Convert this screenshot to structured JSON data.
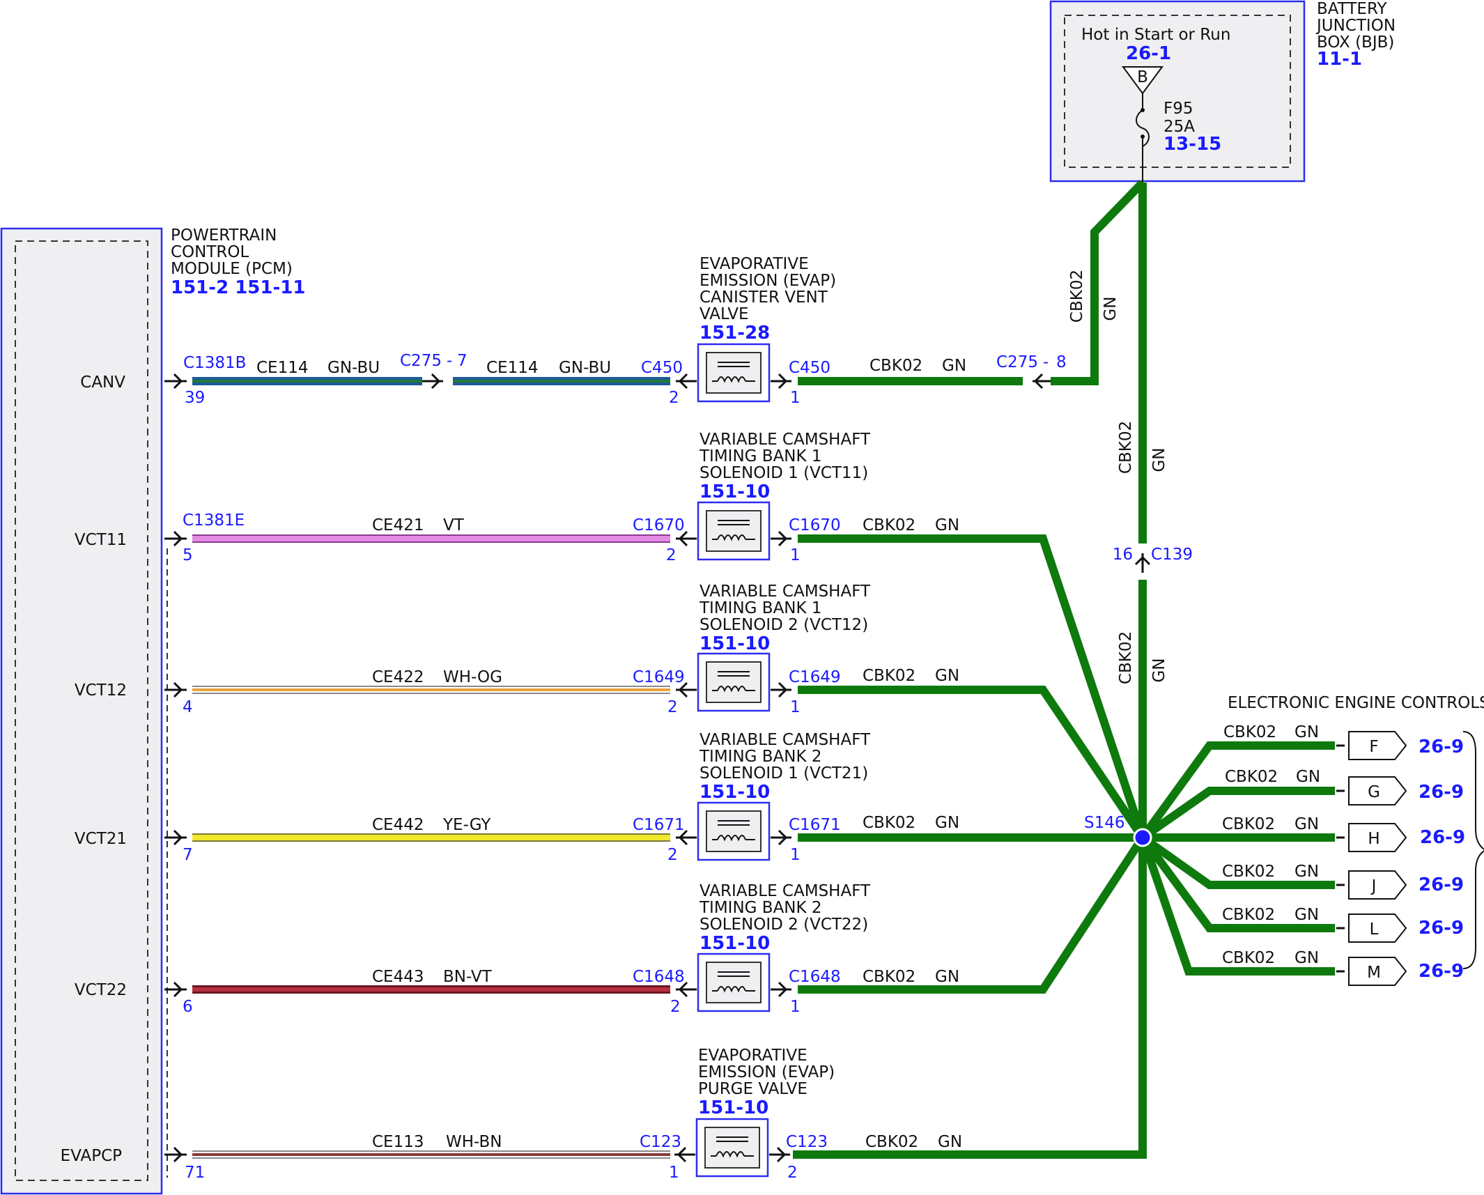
{
  "colors": {
    "module_border": "#2d2df0",
    "module_fill": "#efeff2",
    "link_blue": "#1a1aff",
    "wire_green": "#0e7a0e"
  },
  "pcm": {
    "name_lines": [
      "POWERTRAIN",
      "CONTROL",
      "MODULE (PCM)"
    ],
    "refs": "151-2  151-11",
    "pins": [
      "CANV",
      "VCT11",
      "VCT12",
      "VCT21",
      "VCT22",
      "EVAPCP"
    ]
  },
  "bjb": {
    "name_lines": [
      "BATTERY",
      "JUNCTION",
      "BOX (BJB)"
    ],
    "ref": "11-1",
    "hot_label": "Hot in Start or Run",
    "hot_ref": "26-1",
    "bus_letter": "B",
    "fuse_name": "F95",
    "fuse_rating": "25A",
    "fuse_ref": "13-15"
  },
  "circuits": [
    {
      "pin": "CANV",
      "pcm_connector": "C1381B",
      "pcm_pin": "39",
      "inline_connector": "C275",
      "inline_pin_left": "7",
      "circuit": "CE114",
      "color": "GN-BU",
      "component_lines": [
        "EVAPORATIVE",
        "EMISSION (EVAP)",
        "CANISTER VENT",
        "VALVE"
      ],
      "component_ref": "151-28",
      "comp_connector": "C450",
      "comp_pin_in": "2",
      "comp_pin_out": "1",
      "ret_circuit": "CBK02",
      "ret_color": "GN",
      "ret_inline_connector": "C275",
      "ret_inline_pin": "8"
    },
    {
      "pin": "VCT11",
      "pcm_connector": "C1381E",
      "pcm_pin": "5",
      "circuit": "CE421",
      "color": "VT",
      "component_lines": [
        "VARIABLE CAMSHAFT",
        "TIMING BANK 1",
        "SOLENOID 1 (VCT11)"
      ],
      "component_ref": "151-10",
      "comp_connector": "C1670",
      "comp_pin_in": "2",
      "comp_pin_out": "1",
      "ret_circuit": "CBK02",
      "ret_color": "GN"
    },
    {
      "pin": "VCT12",
      "pcm_pin": "4",
      "circuit": "CE422",
      "color": "WH-OG",
      "component_lines": [
        "VARIABLE CAMSHAFT",
        "TIMING BANK 1",
        "SOLENOID 2 (VCT12)"
      ],
      "component_ref": "151-10",
      "comp_connector": "C1649",
      "comp_pin_in": "2",
      "comp_pin_out": "1",
      "ret_circuit": "CBK02",
      "ret_color": "GN"
    },
    {
      "pin": "VCT21",
      "pcm_pin": "7",
      "circuit": "CE442",
      "color": "YE-GY",
      "component_lines": [
        "VARIABLE CAMSHAFT",
        "TIMING BANK 2",
        "SOLENOID 1 (VCT21)"
      ],
      "component_ref": "151-10",
      "comp_connector": "C1671",
      "comp_pin_in": "2",
      "comp_pin_out": "1",
      "ret_circuit": "CBK02",
      "ret_color": "GN"
    },
    {
      "pin": "VCT22",
      "pcm_pin": "6",
      "circuit": "CE443",
      "color": "BN-VT",
      "component_lines": [
        "VARIABLE CAMSHAFT",
        "TIMING BANK 2",
        "SOLENOID 2 (VCT22)"
      ],
      "component_ref": "151-10",
      "comp_connector": "C1648",
      "comp_pin_in": "2",
      "comp_pin_out": "1",
      "ret_circuit": "CBK02",
      "ret_color": "GN"
    },
    {
      "pin": "EVAPCP",
      "pcm_pin": "71",
      "circuit": "CE113",
      "color": "WH-BN",
      "component_lines": [
        "EVAPORATIVE",
        "EMISSION (EVAP)",
        "PURGE VALVE"
      ],
      "component_ref": "151-10",
      "comp_connector": "C123",
      "comp_pin_in": "1",
      "comp_pin_out": "2",
      "ret_circuit": "CBK02",
      "ret_color": "GN"
    }
  ],
  "feed": {
    "circuit": "CBK02",
    "color": "GN",
    "connector": "C139",
    "connector_pin": "16"
  },
  "splice": {
    "name": "S146"
  },
  "eec": {
    "title": "ELECTRONIC ENGINE CONTROLS",
    "branches": [
      {
        "circuit": "CBK02",
        "color": "GN",
        "letter": "F",
        "ref": "26-9"
      },
      {
        "circuit": "CBK02",
        "color": "GN",
        "letter": "G",
        "ref": "26-9"
      },
      {
        "circuit": "CBK02",
        "color": "GN",
        "letter": "H",
        "ref": "26-9"
      },
      {
        "circuit": "CBK02",
        "color": "GN",
        "letter": "J",
        "ref": "26-9"
      },
      {
        "circuit": "CBK02",
        "color": "GN",
        "letter": "L",
        "ref": "26-9"
      },
      {
        "circuit": "CBK02",
        "color": "GN",
        "letter": "M",
        "ref": "26-9"
      }
    ]
  }
}
